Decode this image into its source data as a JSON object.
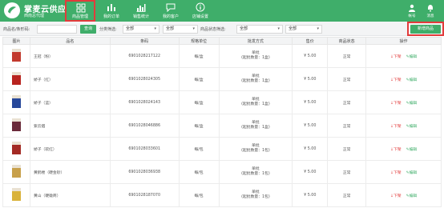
{
  "app": {
    "name": "掌麦云供应",
    "subtitle": "西南总代理"
  },
  "nav": [
    {
      "label": "商品管理",
      "icon": "grid-icon",
      "active": true
    },
    {
      "label": "我的订单",
      "icon": "chart-bars-icon",
      "active": false
    },
    {
      "label": "销售统计",
      "icon": "bar-chart-icon",
      "active": false
    },
    {
      "label": "我的客户",
      "icon": "chat-bubble-icon",
      "active": false
    },
    {
      "label": "店铺设置",
      "icon": "info-icon",
      "active": false
    }
  ],
  "topright": [
    {
      "label": "帐号",
      "icon": "user-icon"
    },
    {
      "label": "消息",
      "icon": "message-icon"
    }
  ],
  "filters": {
    "name_label": "商品名/条形码:",
    "name_placeholder": "",
    "query_label": "查询",
    "category_label": "分类筛选:",
    "category_value": "全部",
    "category2_value": "全部",
    "status_label": "商品状态筛选:",
    "status_value": "全部",
    "status2_value": "全部",
    "add_label": "新增商品"
  },
  "table": {
    "headers": [
      "图片",
      "品名",
      "条码",
      "规格单位",
      "批发方式",
      "售价",
      "商品状态",
      "操作"
    ],
    "rows": [
      {
        "name": "王冠（粉）",
        "barcode": "6901028217122",
        "unit": "每/盒",
        "wholesale_1": "单批",
        "wholesale_2": "(起批数量：1盒)",
        "price": "¥ 5.00",
        "status": "正常",
        "op_down": "下架",
        "op_edit": "编辑",
        "thumb_color": "#c23a2e"
      },
      {
        "name": "娇子（红）",
        "barcode": "6901028024305",
        "unit": "每/盒",
        "wholesale_1": "单批",
        "wholesale_2": "(起批数量：1盒)",
        "price": "¥ 5.00",
        "status": "正常",
        "op_down": "下架",
        "op_edit": "编辑",
        "thumb_color": "#b8241f"
      },
      {
        "name": "娇子（蓝）",
        "barcode": "6901028024143",
        "unit": "每/盒",
        "wholesale_1": "单批",
        "wholesale_2": "(起批数量：1盒)",
        "price": "¥ 5.00",
        "status": "正常",
        "op_down": "下架",
        "op_edit": "编辑",
        "thumb_color": "#27489a"
      },
      {
        "name": "紫云烟",
        "barcode": "6901028046886",
        "unit": "每/盒",
        "wholesale_1": "单批",
        "wholesale_2": "(起批数量：1盒)",
        "price": "¥ 5.00",
        "status": "正常",
        "op_down": "下架",
        "op_edit": "编辑",
        "thumb_color": "#6a2a3a"
      },
      {
        "name": "娇子（软红）",
        "barcode": "6901028033601",
        "unit": "每/包",
        "wholesale_1": "单批",
        "wholesale_2": "(起批数量：1包)",
        "price": "¥ 5.00",
        "status": "正常",
        "op_down": "下架",
        "op_edit": "编辑",
        "thumb_color": "#a32a24"
      },
      {
        "name": "黄鹤楼（硬金砂）",
        "barcode": "6901028036938",
        "unit": "每/包",
        "wholesale_1": "单批",
        "wholesale_2": "(起批数量：1包)",
        "price": "¥ 5.00",
        "status": "正常",
        "op_down": "下架",
        "op_edit": "编辑",
        "thumb_color": "#c8a04a"
      },
      {
        "name": "黄山（硬徽商）",
        "barcode": "6901028187070",
        "unit": "每/包",
        "wholesale_1": "单批",
        "wholesale_2": "(起批数量：1包)",
        "price": "¥ 5.00",
        "status": "正常",
        "op_down": "下架",
        "op_edit": "编辑",
        "thumb_color": "#d9b23a"
      }
    ]
  },
  "colors": {
    "brand": "#3fae6a",
    "highlight": "#e23b3b"
  }
}
